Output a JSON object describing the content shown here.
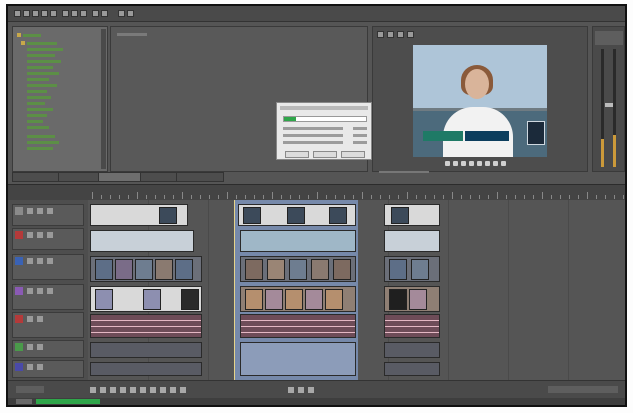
{
  "app": {
    "name": "Video editor"
  },
  "menubar": {
    "icons": [
      "new-icon",
      "open-icon",
      "save-icon",
      "render-icon",
      "properties-icon",
      "cut-icon",
      "copy-icon",
      "paste-icon",
      "undo-icon",
      "redo-icon",
      "select-tool-icon",
      "envelope-tool-icon"
    ]
  },
  "explorer": {
    "title": "",
    "node_count": 18
  },
  "bottom_tabs": [
    {
      "label": "",
      "active": false
    },
    {
      "label": "",
      "active": false
    },
    {
      "label": "",
      "active": true
    },
    {
      "label": "",
      "active": false
    },
    {
      "label": "",
      "active": false
    }
  ],
  "render_dialog": {
    "title": "",
    "progress": 0.15,
    "rows": [
      "",
      "",
      ""
    ],
    "buttons": [
      "",
      "",
      ""
    ]
  },
  "viewer": {
    "lower_third_left": "",
    "lower_third_right": ""
  },
  "timeline": {
    "cursor_time": "",
    "tracks": [
      {
        "type": "video"
      },
      {
        "type": "video"
      },
      {
        "type": "video"
      },
      {
        "type": "video"
      },
      {
        "type": "audio"
      },
      {
        "type": "audio"
      },
      {
        "type": "audio"
      }
    ]
  },
  "colors": {
    "selection": "#7d93ba",
    "progress": "#2fa64a",
    "audio_clip": "#6e4c58",
    "timecode": "#e6d38a"
  }
}
